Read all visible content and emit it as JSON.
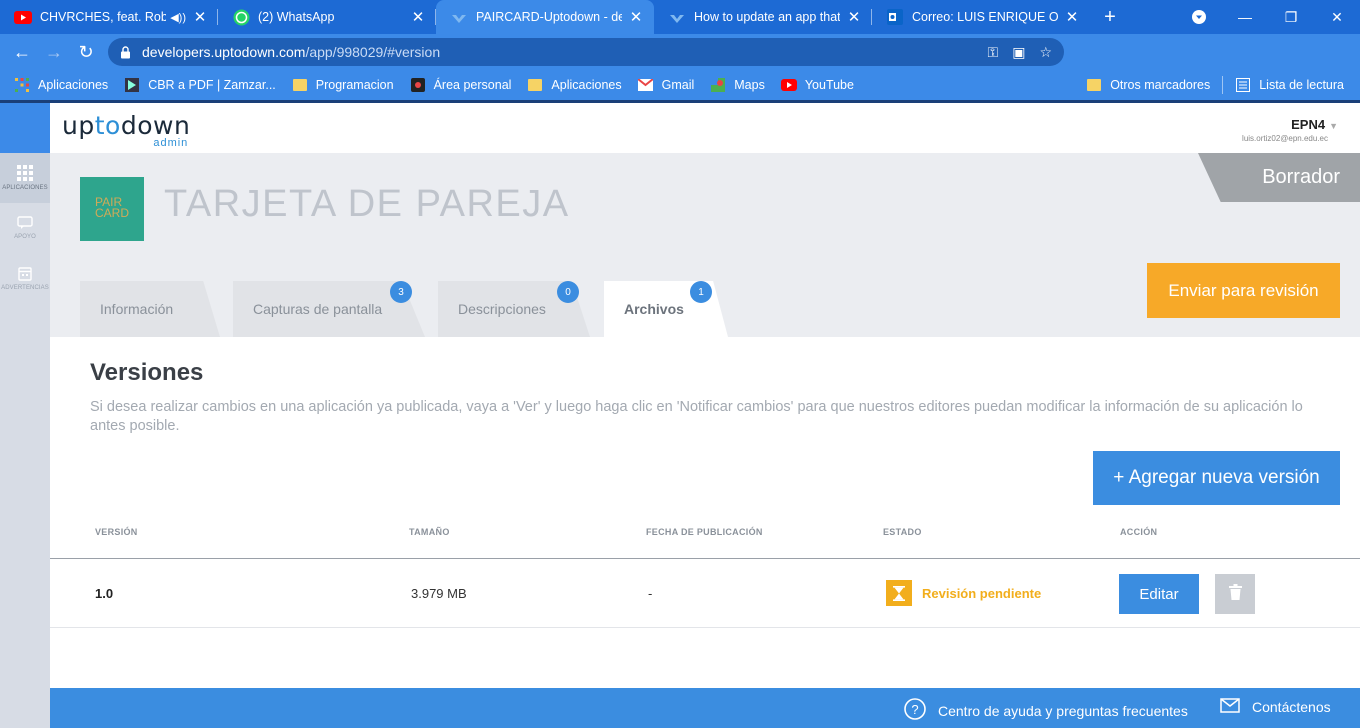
{
  "browser": {
    "tabs": [
      {
        "title": "CHVRCHES, feat. Robert S",
        "icon": "youtube-icon"
      },
      {
        "title": "(2) WhatsApp",
        "icon": "whatsapp-icon"
      },
      {
        "title": "PAIRCARD-Uptodown - desar",
        "icon": "uptodown-icon"
      },
      {
        "title": "How to update an app that y",
        "icon": "uptodown-icon"
      },
      {
        "title": "Correo: LUIS ENRIQUE ORTIZ",
        "icon": "outlook-icon"
      }
    ],
    "url_host": "developers.uptodown.com",
    "url_path": "/app/998029/#version",
    "bookmarks": [
      "Aplicaciones",
      "CBR a PDF | Zamzar...",
      "Programacion",
      "Área personal",
      "Aplicaciones",
      "Gmail",
      "Maps",
      "YouTube"
    ],
    "bookmarks_right": [
      "Otros marcadores",
      "Lista de lectura"
    ]
  },
  "sidebar": {
    "items": [
      {
        "label": "APLICACIONES",
        "icon": "grid-icon"
      },
      {
        "label": "APOYO",
        "icon": "chat-icon"
      },
      {
        "label": "ADVERTENCIAS",
        "icon": "calendar-icon"
      }
    ]
  },
  "header": {
    "logo_a": "up",
    "logo_b": "to",
    "logo_c": "down",
    "logo_sub": "admin",
    "user_name": "EPN4",
    "user_email": "luis.ortiz02@epn.edu.ec"
  },
  "app": {
    "icon_line1": "PAIR",
    "icon_line2": "CARD",
    "title": "TARJETA DE PAREJA",
    "status": "Borrador",
    "send_button": "Enviar para revisión"
  },
  "tabs": [
    {
      "label": "Información",
      "badge": ""
    },
    {
      "label": "Capturas de pantalla",
      "badge": "3"
    },
    {
      "label": "Descripciones",
      "badge": "0"
    },
    {
      "label": "Archivos",
      "badge": "1"
    }
  ],
  "versions": {
    "title": "Versiones",
    "description": "Si desea realizar cambios en una aplicación ya publicada, vaya a 'Ver' y luego haga clic en 'Notificar cambios' para que nuestros editores puedan modificar la información de su aplicación lo antes posible.",
    "add_button": "+ Agregar nueva versión",
    "columns": [
      "VERSIÓN",
      "TAMAÑO",
      "FECHA DE PUBLICACIÓN",
      "ESTADO",
      "ACCIÓN"
    ],
    "rows": [
      {
        "version": "1.0",
        "size": "3.979 MB",
        "date": "-",
        "status": "Revisión pendiente",
        "edit": "Editar"
      }
    ]
  },
  "footer": {
    "help": "Centro de ayuda y preguntas frecuentes",
    "contact": "Contáctenos"
  },
  "colors": {
    "accent": "#3b8de0",
    "orange": "#f7a928",
    "pending": "#f2ae1c",
    "draft": "#a0a4a8"
  }
}
